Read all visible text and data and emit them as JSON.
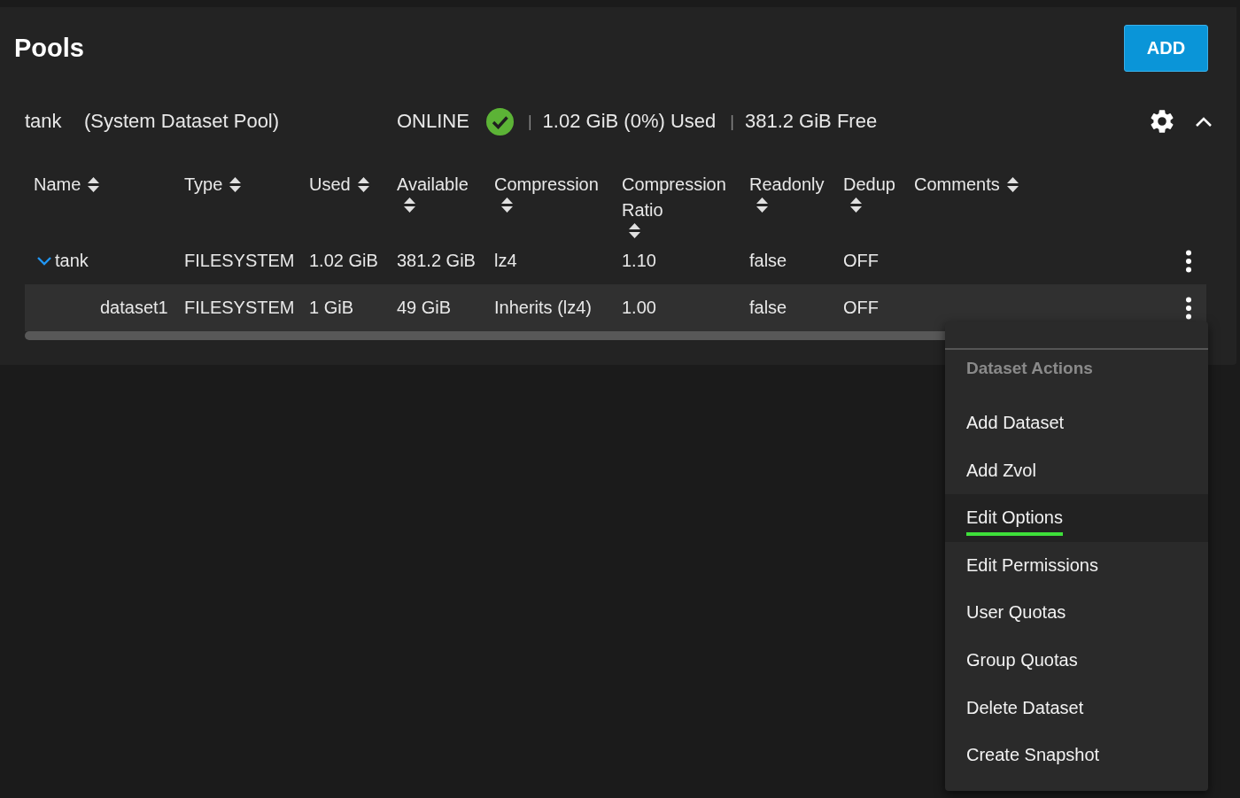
{
  "page": {
    "title": "Pools",
    "add_button": "ADD"
  },
  "pool": {
    "name": "tank",
    "note": "(System Dataset Pool)",
    "status": "ONLINE",
    "healthy": true,
    "expanded": true,
    "stats": [
      {
        "separator": "|",
        "text": "1.02 GiB (0%) Used"
      },
      {
        "separator": "|",
        "text": "381.2 GiB Free"
      }
    ]
  },
  "table": {
    "columns": [
      {
        "label": "Name"
      },
      {
        "label": "Type"
      },
      {
        "label": "Used"
      },
      {
        "label": "Available"
      },
      {
        "label": "Compression"
      },
      {
        "label": "Compression Ratio"
      },
      {
        "label": "Readonly"
      },
      {
        "label": "Dedup"
      },
      {
        "label": "Comments"
      }
    ],
    "rows": [
      {
        "name": "tank",
        "type": "FILESYSTEM",
        "used": "1.02 GiB",
        "available": "381.2 GiB",
        "compression": "lz4",
        "ratio": "1.10",
        "readonly": "false",
        "dedup": "OFF",
        "selected": false,
        "expanded": true,
        "children": [
          {
            "name": "dataset1",
            "type": "FILESYSTEM",
            "used": "1 GiB",
            "available": "49 GiB",
            "compression": "Inherits (lz4)",
            "ratio": "1.00",
            "readonly": "false",
            "dedup": "OFF",
            "selected": true
          }
        ]
      }
    ]
  },
  "menu": {
    "title": "Dataset Actions",
    "items": [
      {
        "label": "Add Dataset",
        "selected": false
      },
      {
        "label": "Add Zvol",
        "selected": false
      },
      {
        "label": "Edit Options",
        "selected": true
      },
      {
        "label": "Edit Permissions",
        "selected": false
      },
      {
        "label": "User Quotas",
        "selected": false
      },
      {
        "label": "Group Quotas",
        "selected": false
      },
      {
        "label": "Delete Dataset",
        "selected": false
      },
      {
        "label": "Create Snapshot",
        "selected": false
      }
    ]
  }
}
